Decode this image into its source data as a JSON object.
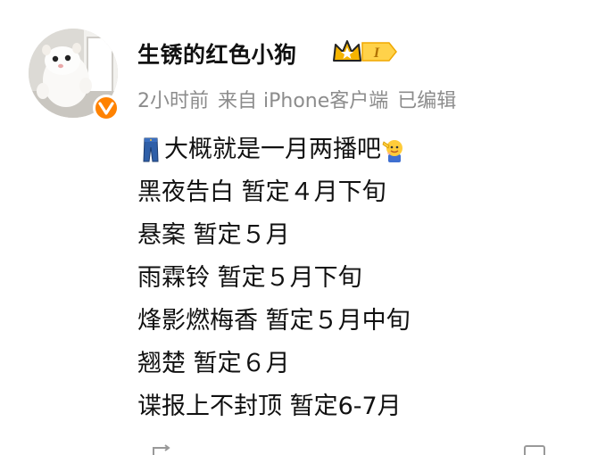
{
  "post": {
    "author": "生锈的红色小狗",
    "vip_level": "I",
    "time": "2小时前",
    "source": "来自 iPhone客户端",
    "edited": "已编辑",
    "lines": [
      "大概就是一月两播吧",
      "黑夜告白 暂定４月下旬",
      "悬案 暂定５月",
      "雨霖铃 暂定５月下旬",
      "烽影燃梅香 暂定５月中旬",
      "翘楚 暂定６月",
      "谍报上不封顶 暂定6-7月"
    ],
    "line_icons": {
      "first_prefix": "jeans-icon",
      "first_suffix": "salute-emoji-icon"
    }
  },
  "colors": {
    "meta_text": "#8c8c8c",
    "verified_badge": "#ff8200",
    "vip_gold": "#f5b400"
  },
  "icons": {
    "verified": "verified-v-badge-icon",
    "vip": "crown-vip-badge-icon"
  }
}
